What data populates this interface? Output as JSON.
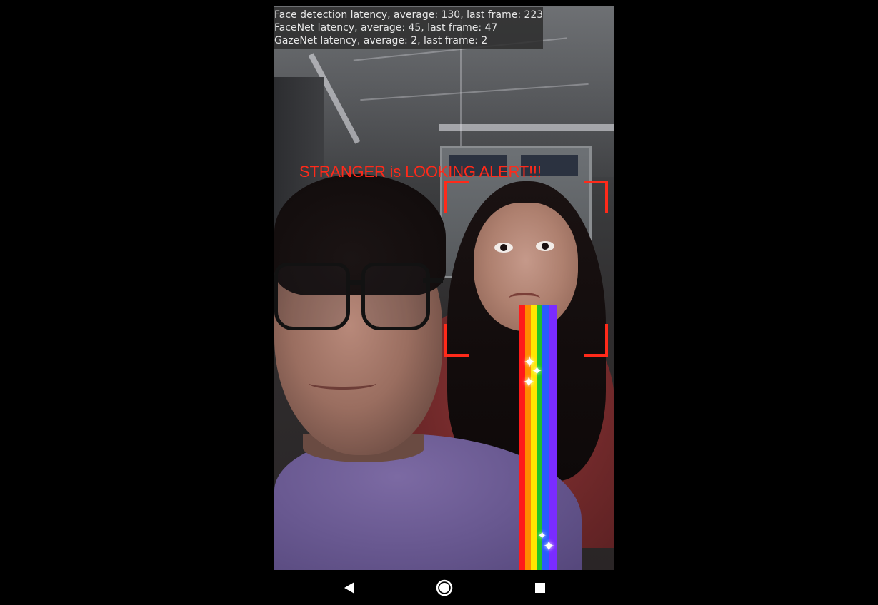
{
  "latency": {
    "face_detection": "Face detection latency, average: 130, last frame: 223",
    "facenet": "FaceNet latency, average: 45, last frame: 47",
    "gazenet": "GazeNet latency, average: 2, last frame: 2"
  },
  "alert": {
    "text": "STRANGER is LOOKING ALERT!!!",
    "color": "#ff2a1a"
  },
  "nav": {
    "back_icon": "back-triangle-icon",
    "home_icon": "home-circle-icon",
    "recents_icon": "recents-square-icon"
  },
  "colors": {
    "bracket": "#ff2a1a",
    "rainbow": [
      "#ff1a1a",
      "#ff8a00",
      "#ffe600",
      "#22c22a",
      "#2a5bff",
      "#7a2cff"
    ]
  }
}
